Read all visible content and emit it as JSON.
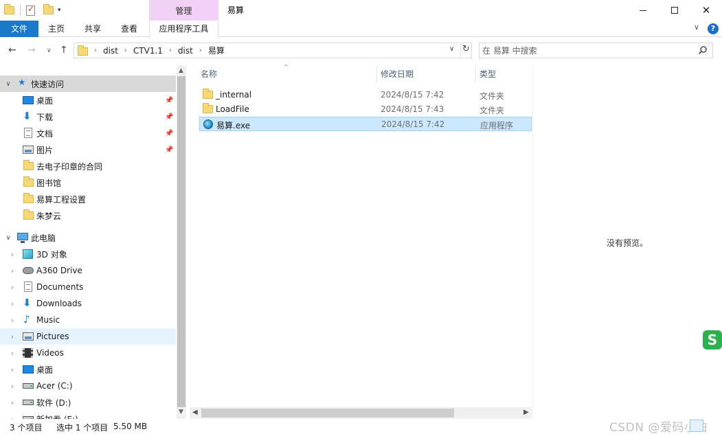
{
  "titlebar": {
    "context_tab_header": "管理",
    "window_title": "易算"
  },
  "ribbon": {
    "tabs": [
      "文件",
      "主页",
      "共享",
      "查看",
      "应用程序工具"
    ]
  },
  "address": {
    "crumbs": [
      "dist",
      "CTV1.1",
      "dist",
      "易算"
    ]
  },
  "search": {
    "placeholder": "在 易算 中搜索"
  },
  "nav": {
    "quick_access": "快速访问",
    "quick_items": [
      {
        "label": "桌面",
        "icon": "desktop-icon",
        "pinned": true
      },
      {
        "label": "下载",
        "icon": "download-icon",
        "pinned": true
      },
      {
        "label": "文档",
        "icon": "document-icon",
        "pinned": true
      },
      {
        "label": "图片",
        "icon": "pictures-icon",
        "pinned": true
      },
      {
        "label": "去电子印章的合同",
        "icon": "folder-icon",
        "pinned": false
      },
      {
        "label": "图书馆",
        "icon": "folder-icon",
        "pinned": false
      },
      {
        "label": "易算工程设置",
        "icon": "folder-icon",
        "pinned": false
      },
      {
        "label": "朱梦云",
        "icon": "folder-icon",
        "pinned": false
      }
    ],
    "this_pc": "此电脑",
    "pc_items": [
      {
        "label": "3D 对象",
        "icon": "3d-objects-icon"
      },
      {
        "label": "A360 Drive",
        "icon": "cloud-drive-icon"
      },
      {
        "label": "Documents",
        "icon": "document-icon"
      },
      {
        "label": "Downloads",
        "icon": "download-icon"
      },
      {
        "label": "Music",
        "icon": "music-icon"
      },
      {
        "label": "Pictures",
        "icon": "pictures-icon"
      },
      {
        "label": "Videos",
        "icon": "video-icon"
      },
      {
        "label": "桌面",
        "icon": "desktop-icon"
      },
      {
        "label": "Acer (C:)",
        "icon": "windows-drive-icon"
      },
      {
        "label": "软件 (D:)",
        "icon": "drive-icon"
      },
      {
        "label": "新加卷 (E:)",
        "icon": "drive-icon"
      }
    ]
  },
  "files": {
    "columns": {
      "name": "名称",
      "date": "修改日期",
      "type": "类型"
    },
    "rows": [
      {
        "name": "_internal",
        "date": "2024/8/15 7:42",
        "type": "文件夹",
        "icon": "folder-icon"
      },
      {
        "name": "LoadFile",
        "date": "2024/8/15 7:43",
        "type": "文件夹",
        "icon": "folder-icon"
      },
      {
        "name": "易算.exe",
        "date": "2024/8/15 7:42",
        "type": "应用程序",
        "icon": "exe-icon"
      }
    ]
  },
  "preview": {
    "message": "没有预览。"
  },
  "status": {
    "count": "3 个项目",
    "selected": "选中 1 个项目",
    "size": "5.50 MB"
  },
  "watermark": "CSDN @爱码小白"
}
